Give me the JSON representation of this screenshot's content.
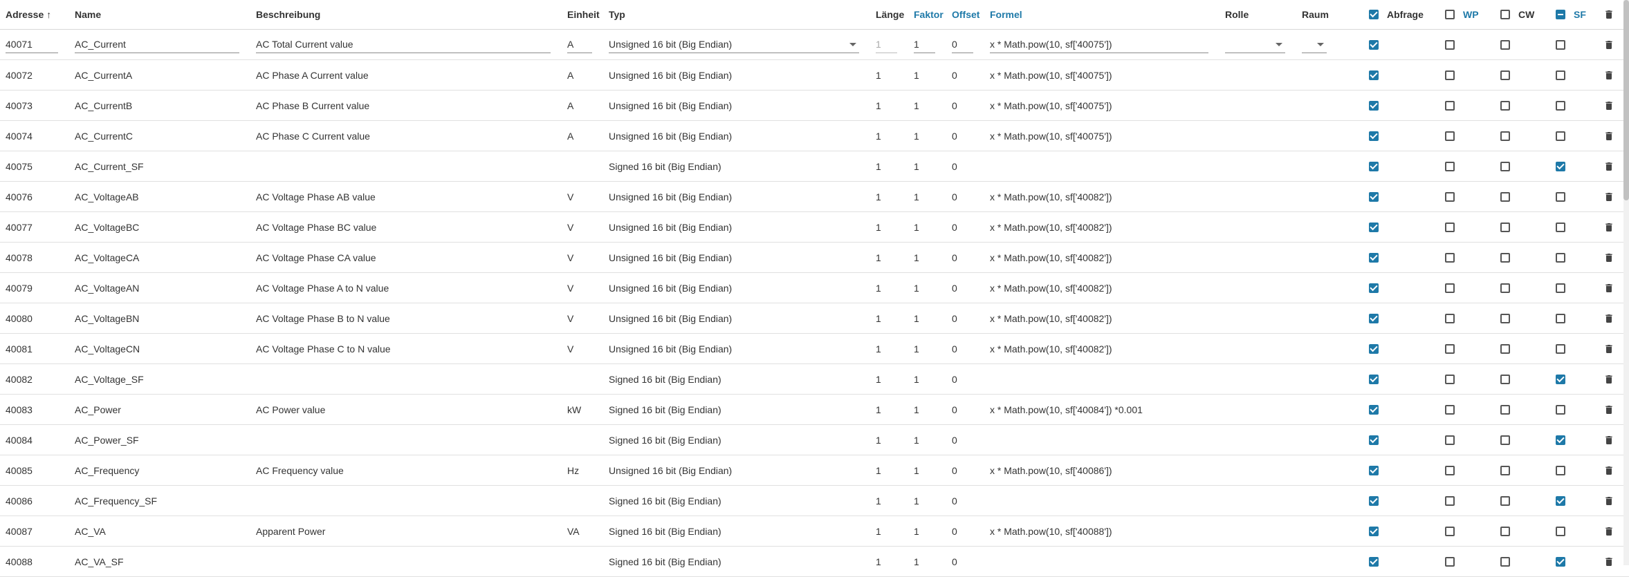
{
  "header": {
    "address": "Adresse",
    "name": "Name",
    "description": "Beschreibung",
    "unit": "Einheit",
    "type": "Typ",
    "length": "Länge",
    "factor": "Faktor",
    "offset": "Offset",
    "formula": "Formel",
    "role": "Rolle",
    "room": "Raum",
    "poll": "Abfrage",
    "wp": "WP",
    "cw": "CW",
    "sf": "SF",
    "sort_arrow": "↑"
  },
  "colors": {
    "accent": "#1e79a8"
  },
  "rows": [
    {
      "address": "40071",
      "name": "AC_Current",
      "description": "AC Total Current value",
      "unit": "A",
      "type": "Unsigned 16 bit (Big Endian)",
      "length": "1",
      "factor": "1",
      "offset": "0",
      "formula": "x * Math.pow(10, sf['40075'])",
      "poll": true,
      "wp": false,
      "cw": false,
      "sf": false
    },
    {
      "address": "40072",
      "name": "AC_CurrentA",
      "description": "AC Phase A Current value",
      "unit": "A",
      "type": "Unsigned 16 bit (Big Endian)",
      "length": "1",
      "factor": "1",
      "offset": "0",
      "formula": "x * Math.pow(10, sf['40075'])",
      "poll": true,
      "wp": false,
      "cw": false,
      "sf": false
    },
    {
      "address": "40073",
      "name": "AC_CurrentB",
      "description": "AC Phase B Current value",
      "unit": "A",
      "type": "Unsigned 16 bit (Big Endian)",
      "length": "1",
      "factor": "1",
      "offset": "0",
      "formula": "x * Math.pow(10, sf['40075'])",
      "poll": true,
      "wp": false,
      "cw": false,
      "sf": false
    },
    {
      "address": "40074",
      "name": "AC_CurrentC",
      "description": "AC Phase C Current value",
      "unit": "A",
      "type": "Unsigned 16 bit (Big Endian)",
      "length": "1",
      "factor": "1",
      "offset": "0",
      "formula": "x * Math.pow(10, sf['40075'])",
      "poll": true,
      "wp": false,
      "cw": false,
      "sf": false
    },
    {
      "address": "40075",
      "name": "AC_Current_SF",
      "description": "",
      "unit": "",
      "type": "Signed 16 bit (Big Endian)",
      "length": "1",
      "factor": "1",
      "offset": "0",
      "formula": "",
      "poll": true,
      "wp": false,
      "cw": false,
      "sf": true
    },
    {
      "address": "40076",
      "name": "AC_VoltageAB",
      "description": "AC Voltage Phase AB value",
      "unit": "V",
      "type": "Unsigned 16 bit (Big Endian)",
      "length": "1",
      "factor": "1",
      "offset": "0",
      "formula": "x * Math.pow(10, sf['40082'])",
      "poll": true,
      "wp": false,
      "cw": false,
      "sf": false
    },
    {
      "address": "40077",
      "name": "AC_VoltageBC",
      "description": "AC Voltage Phase BC value",
      "unit": "V",
      "type": "Unsigned 16 bit (Big Endian)",
      "length": "1",
      "factor": "1",
      "offset": "0",
      "formula": "x * Math.pow(10, sf['40082'])",
      "poll": true,
      "wp": false,
      "cw": false,
      "sf": false
    },
    {
      "address": "40078",
      "name": "AC_VoltageCA",
      "description": "AC Voltage Phase CA value",
      "unit": "V",
      "type": "Unsigned 16 bit (Big Endian)",
      "length": "1",
      "factor": "1",
      "offset": "0",
      "formula": "x * Math.pow(10, sf['40082'])",
      "poll": true,
      "wp": false,
      "cw": false,
      "sf": false
    },
    {
      "address": "40079",
      "name": "AC_VoltageAN",
      "description": "AC Voltage Phase A to N value",
      "unit": "V",
      "type": "Unsigned 16 bit (Big Endian)",
      "length": "1",
      "factor": "1",
      "offset": "0",
      "formula": "x * Math.pow(10, sf['40082'])",
      "poll": true,
      "wp": false,
      "cw": false,
      "sf": false
    },
    {
      "address": "40080",
      "name": "AC_VoltageBN",
      "description": "AC Voltage Phase B to N value",
      "unit": "V",
      "type": "Unsigned 16 bit (Big Endian)",
      "length": "1",
      "factor": "1",
      "offset": "0",
      "formula": "x * Math.pow(10, sf['40082'])",
      "poll": true,
      "wp": false,
      "cw": false,
      "sf": false
    },
    {
      "address": "40081",
      "name": "AC_VoltageCN",
      "description": "AC Voltage Phase C to N value",
      "unit": "V",
      "type": "Unsigned 16 bit (Big Endian)",
      "length": "1",
      "factor": "1",
      "offset": "0",
      "formula": "x * Math.pow(10, sf['40082'])",
      "poll": true,
      "wp": false,
      "cw": false,
      "sf": false
    },
    {
      "address": "40082",
      "name": "AC_Voltage_SF",
      "description": "",
      "unit": "",
      "type": "Signed 16 bit (Big Endian)",
      "length": "1",
      "factor": "1",
      "offset": "0",
      "formula": "",
      "poll": true,
      "wp": false,
      "cw": false,
      "sf": true
    },
    {
      "address": "40083",
      "name": "AC_Power",
      "description": "AC Power value",
      "unit": "kW",
      "type": "Signed 16 bit (Big Endian)",
      "length": "1",
      "factor": "1",
      "offset": "0",
      "formula": "x * Math.pow(10, sf['40084']) *0.001",
      "poll": true,
      "wp": false,
      "cw": false,
      "sf": false
    },
    {
      "address": "40084",
      "name": "AC_Power_SF",
      "description": "",
      "unit": "",
      "type": "Signed 16 bit (Big Endian)",
      "length": "1",
      "factor": "1",
      "offset": "0",
      "formula": "",
      "poll": true,
      "wp": false,
      "cw": false,
      "sf": true
    },
    {
      "address": "40085",
      "name": "AC_Frequency",
      "description": "AC Frequency value",
      "unit": "Hz",
      "type": "Unsigned 16 bit (Big Endian)",
      "length": "1",
      "factor": "1",
      "offset": "0",
      "formula": "x * Math.pow(10, sf['40086'])",
      "poll": true,
      "wp": false,
      "cw": false,
      "sf": false
    },
    {
      "address": "40086",
      "name": "AC_Frequency_SF",
      "description": "",
      "unit": "",
      "type": "Signed 16 bit (Big Endian)",
      "length": "1",
      "factor": "1",
      "offset": "0",
      "formula": "",
      "poll": true,
      "wp": false,
      "cw": false,
      "sf": true
    },
    {
      "address": "40087",
      "name": "AC_VA",
      "description": "Apparent Power",
      "unit": "VA",
      "type": "Signed 16 bit (Big Endian)",
      "length": "1",
      "factor": "1",
      "offset": "0",
      "formula": "x * Math.pow(10, sf['40088'])",
      "poll": true,
      "wp": false,
      "cw": false,
      "sf": false
    },
    {
      "address": "40088",
      "name": "AC_VA_SF",
      "description": "",
      "unit": "",
      "type": "Signed 16 bit (Big Endian)",
      "length": "1",
      "factor": "1",
      "offset": "0",
      "formula": "",
      "poll": true,
      "wp": false,
      "cw": false,
      "sf": true
    }
  ]
}
